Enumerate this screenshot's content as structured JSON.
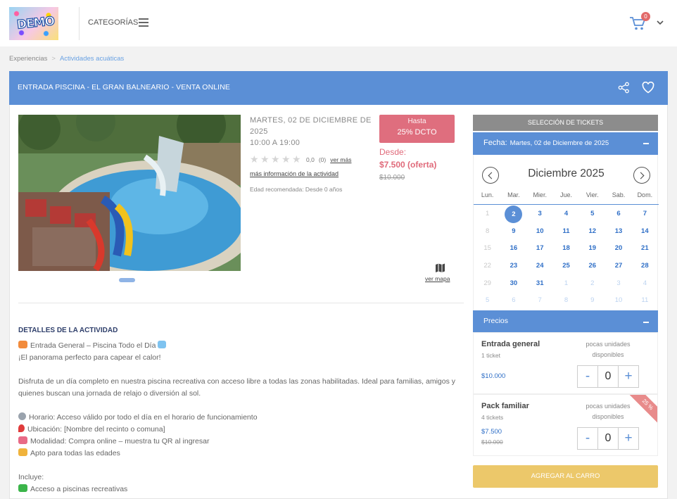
{
  "header": {
    "logo_text": "DEMO",
    "categories_label": "CATEGORÍAS",
    "cart_count": "0"
  },
  "breadcrumb": {
    "items": [
      "Experiencias",
      "Actividades acuáticas"
    ],
    "separator": ">"
  },
  "event": {
    "title": "ENTRADA PISCINA - EL GRAN BALNEARIO - VENTA ONLINE",
    "date": "MARTES, 02 DE DICIEMBRE DE 2025",
    "time": "10:00 A 19:00",
    "rating_value": "0,0",
    "rating_count": "(0)",
    "ver_mas": "ver más",
    "more_info": "más información de la actividad",
    "age": "Edad recomendada: Desde 0 años",
    "promo_line1": "Hasta",
    "promo_line2": "25% DCTO",
    "desde_label": "Desde:",
    "price_offer": "$7.500 (oferta)",
    "price_old": "$10.000",
    "map_link": "ver mapa"
  },
  "details": {
    "heading": "DETALLES DE LA ACTIVIDAD",
    "lines": [
      "Entrada General – Piscina Todo el Día",
      "¡El panorama perfecto para capear el calor!",
      "",
      "Disfruta de un día completo en nuestra piscina recreativa con acceso libre a todas las zonas habilitadas. Ideal para familias, amigos y quienes buscan una jornada de relajo o diversión al sol.",
      "",
      "Horario: Acceso válido por todo el día en el horario de funcionamiento",
      "Ubicación: [Nombre del recinto o comuna]",
      "Modalidad: Compra online – muestra tu QR al ingresar",
      "Apto para todas las edades",
      "",
      "Incluye:",
      "Acceso a piscinas recreativas"
    ]
  },
  "tickets_panel": {
    "title": "SELECCIÓN DE TICKETS",
    "fecha_label": "Fecha:",
    "fecha_value": "Martes, 02 de Diciembre de 2025",
    "month_label": "Diciembre 2025",
    "weekdays": [
      "Lun.",
      "Mar.",
      "Mier.",
      "Jue.",
      "Vier.",
      "Sab.",
      "Dom."
    ],
    "weeks": [
      [
        "1",
        "2",
        "3",
        "4",
        "5",
        "6",
        "7"
      ],
      [
        "8",
        "9",
        "10",
        "11",
        "12",
        "13",
        "14"
      ],
      [
        "15",
        "16",
        "17",
        "18",
        "19",
        "20",
        "21"
      ],
      [
        "22",
        "23",
        "24",
        "25",
        "26",
        "27",
        "28"
      ],
      [
        "29",
        "30",
        "31",
        "1",
        "2",
        "3",
        "4"
      ],
      [
        "5",
        "6",
        "7",
        "8",
        "9",
        "10",
        "11"
      ]
    ],
    "selected_day": "2",
    "precios_label": "Precios",
    "tickets": [
      {
        "name": "Entrada general",
        "count": "1 ticket",
        "stock": "pocas unidades disponibles",
        "price": "$10.000",
        "qty": "0"
      },
      {
        "name": "Pack familiar",
        "count": "4 tickets",
        "stock": "pocas unidades disponibles",
        "price": "$7.500",
        "old_price": "$10.000",
        "qty": "0",
        "badge": "25 %"
      }
    ],
    "qty_minus": "-",
    "qty_plus": "+",
    "add_to_cart": "AGREGAR AL CARRO"
  }
}
